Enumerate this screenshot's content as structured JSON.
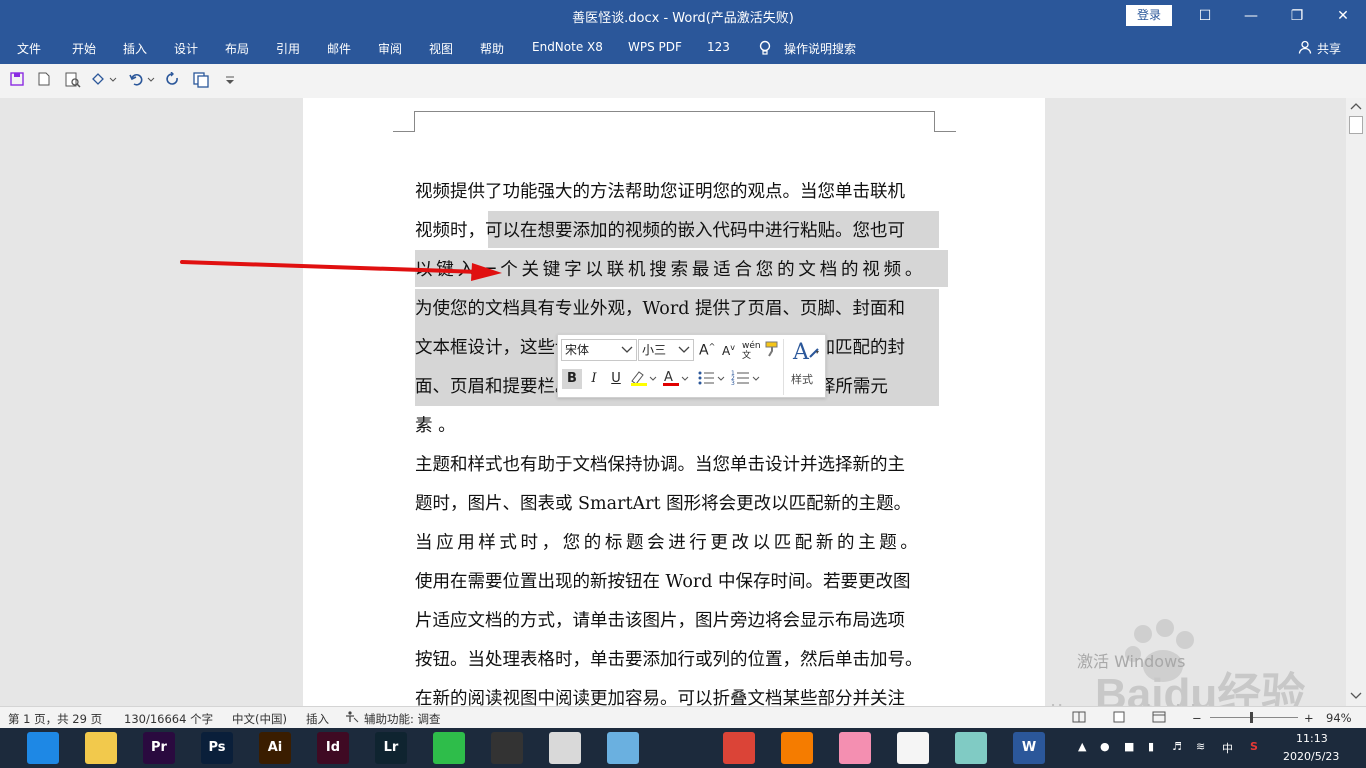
{
  "window": {
    "title": "善医怪谈.docx  -  Word(产品激活失败)",
    "login_label": "登录",
    "buttons": {
      "ribbon_opts": "☐",
      "minimize": "—",
      "restore": "❐",
      "close": "✕"
    }
  },
  "menu": {
    "items": [
      "文件",
      "开始",
      "插入",
      "设计",
      "布局",
      "引用",
      "邮件",
      "审阅",
      "视图",
      "帮助",
      "EndNote X8",
      "WPS PDF",
      "123"
    ],
    "search_label": "操作说明搜索",
    "share_label": "共享"
  },
  "qat": {
    "icons": [
      "save-icon",
      "new-document-icon",
      "print-preview-icon",
      "touch-mode-icon",
      "undo-icon",
      "redo-icon",
      "copy-icon",
      "customize-icon"
    ]
  },
  "document": {
    "lines": [
      "视频提供了功能强大的方法帮助您证明您的观点。当您单击联机",
      "视频时，可以在想要添加的视频的嵌入代码中进行粘贴。您也可",
      "以键入一个关键字以联机搜索最适合您的文档的视频。",
      "为使您的文档具有专业外观，Word 提供了页眉、页脚、封面和",
      "文本框设计，这些设计可互为补充。例如，您可以添加匹配的封",
      "面、页眉和提要栏。单击“插入”，然后从不同库中选择所需元",
      "素                                                  。",
      "主题和样式也有助于文档保持协调。当您单击设计并选择新的主",
      "题时，图片、图表或 SmartArt 图形将会更改以匹配新的主题。",
      "当应用样式时，您的标题会进行更改以匹配新的主题。",
      "使用在需要位置出现的新按钮在 Word 中保存时间。若要更改图",
      "片适应文档的方式，请单击该图片，图片旁边将会显示布局选项",
      "按钮。当处理表格时，单击要添加行或列的位置，然后单击加号。",
      "在新的阅读视图中阅读更加容易。可以折叠文档某些部分并关注"
    ]
  },
  "mini_toolbar": {
    "font": "宋体",
    "size": "小三",
    "styles_label": "样式",
    "bold": "B",
    "italic": "I",
    "underline": "U"
  },
  "status": {
    "page": "第 1 页，共 29 页",
    "words": "130/16664 个字",
    "language": "中文(中国)",
    "mode": "插入",
    "accessibility": "辅助功能: 调查",
    "zoom": "94%",
    "zoom_minus": "−",
    "zoom_plus": "+"
  },
  "taskbar": {
    "apps": [
      {
        "name": "browser-app",
        "label": "",
        "color": "#1e88e5"
      },
      {
        "name": "file-explorer-app",
        "label": "",
        "color": "#f2c94c"
      },
      {
        "name": "premiere-app",
        "label": "Pr",
        "color": "#2a0a3f"
      },
      {
        "name": "photoshop-app",
        "label": "Ps",
        "color": "#0a1f3a"
      },
      {
        "name": "illustrator-app",
        "label": "Ai",
        "color": "#3a1d00"
      },
      {
        "name": "indesign-app",
        "label": "Id",
        "color": "#3f0a23"
      },
      {
        "name": "lightroom-app",
        "label": "Lr",
        "color": "#0f2430"
      },
      {
        "name": "green-app",
        "label": "",
        "color": "#2ebd4a"
      },
      {
        "name": "video-app",
        "label": "",
        "color": "#333333"
      },
      {
        "name": "shapes-app",
        "label": "",
        "color": "#d9d9d9"
      },
      {
        "name": "wechat-like-app",
        "label": "",
        "color": "#6ab0e0"
      },
      {
        "name": "qq-app",
        "label": "",
        "color": "#1c2a3c"
      },
      {
        "name": "chrome-app",
        "label": "",
        "color": "#db4437"
      },
      {
        "name": "fox-app",
        "label": "",
        "color": "#f57c00"
      },
      {
        "name": "pig-app",
        "label": "",
        "color": "#f48fb1"
      },
      {
        "name": "thumb-app",
        "label": "",
        "color": "#f5f5f5"
      },
      {
        "name": "notes-app",
        "label": "",
        "color": "#80cbc4"
      },
      {
        "name": "word-app",
        "label": "W",
        "color": "#2b579a"
      }
    ],
    "ime": "中",
    "time": "11:13",
    "date": "2020/5/23"
  },
  "watermark": {
    "activate_text": "激活 Windows",
    "brand_text": "Baidu经验",
    "url_text": "jingyan.baidu.com"
  },
  "colors": {
    "word_blue": "#2b579a",
    "selection_gray": "#d6d6d6",
    "arrow_red": "#e01010"
  }
}
